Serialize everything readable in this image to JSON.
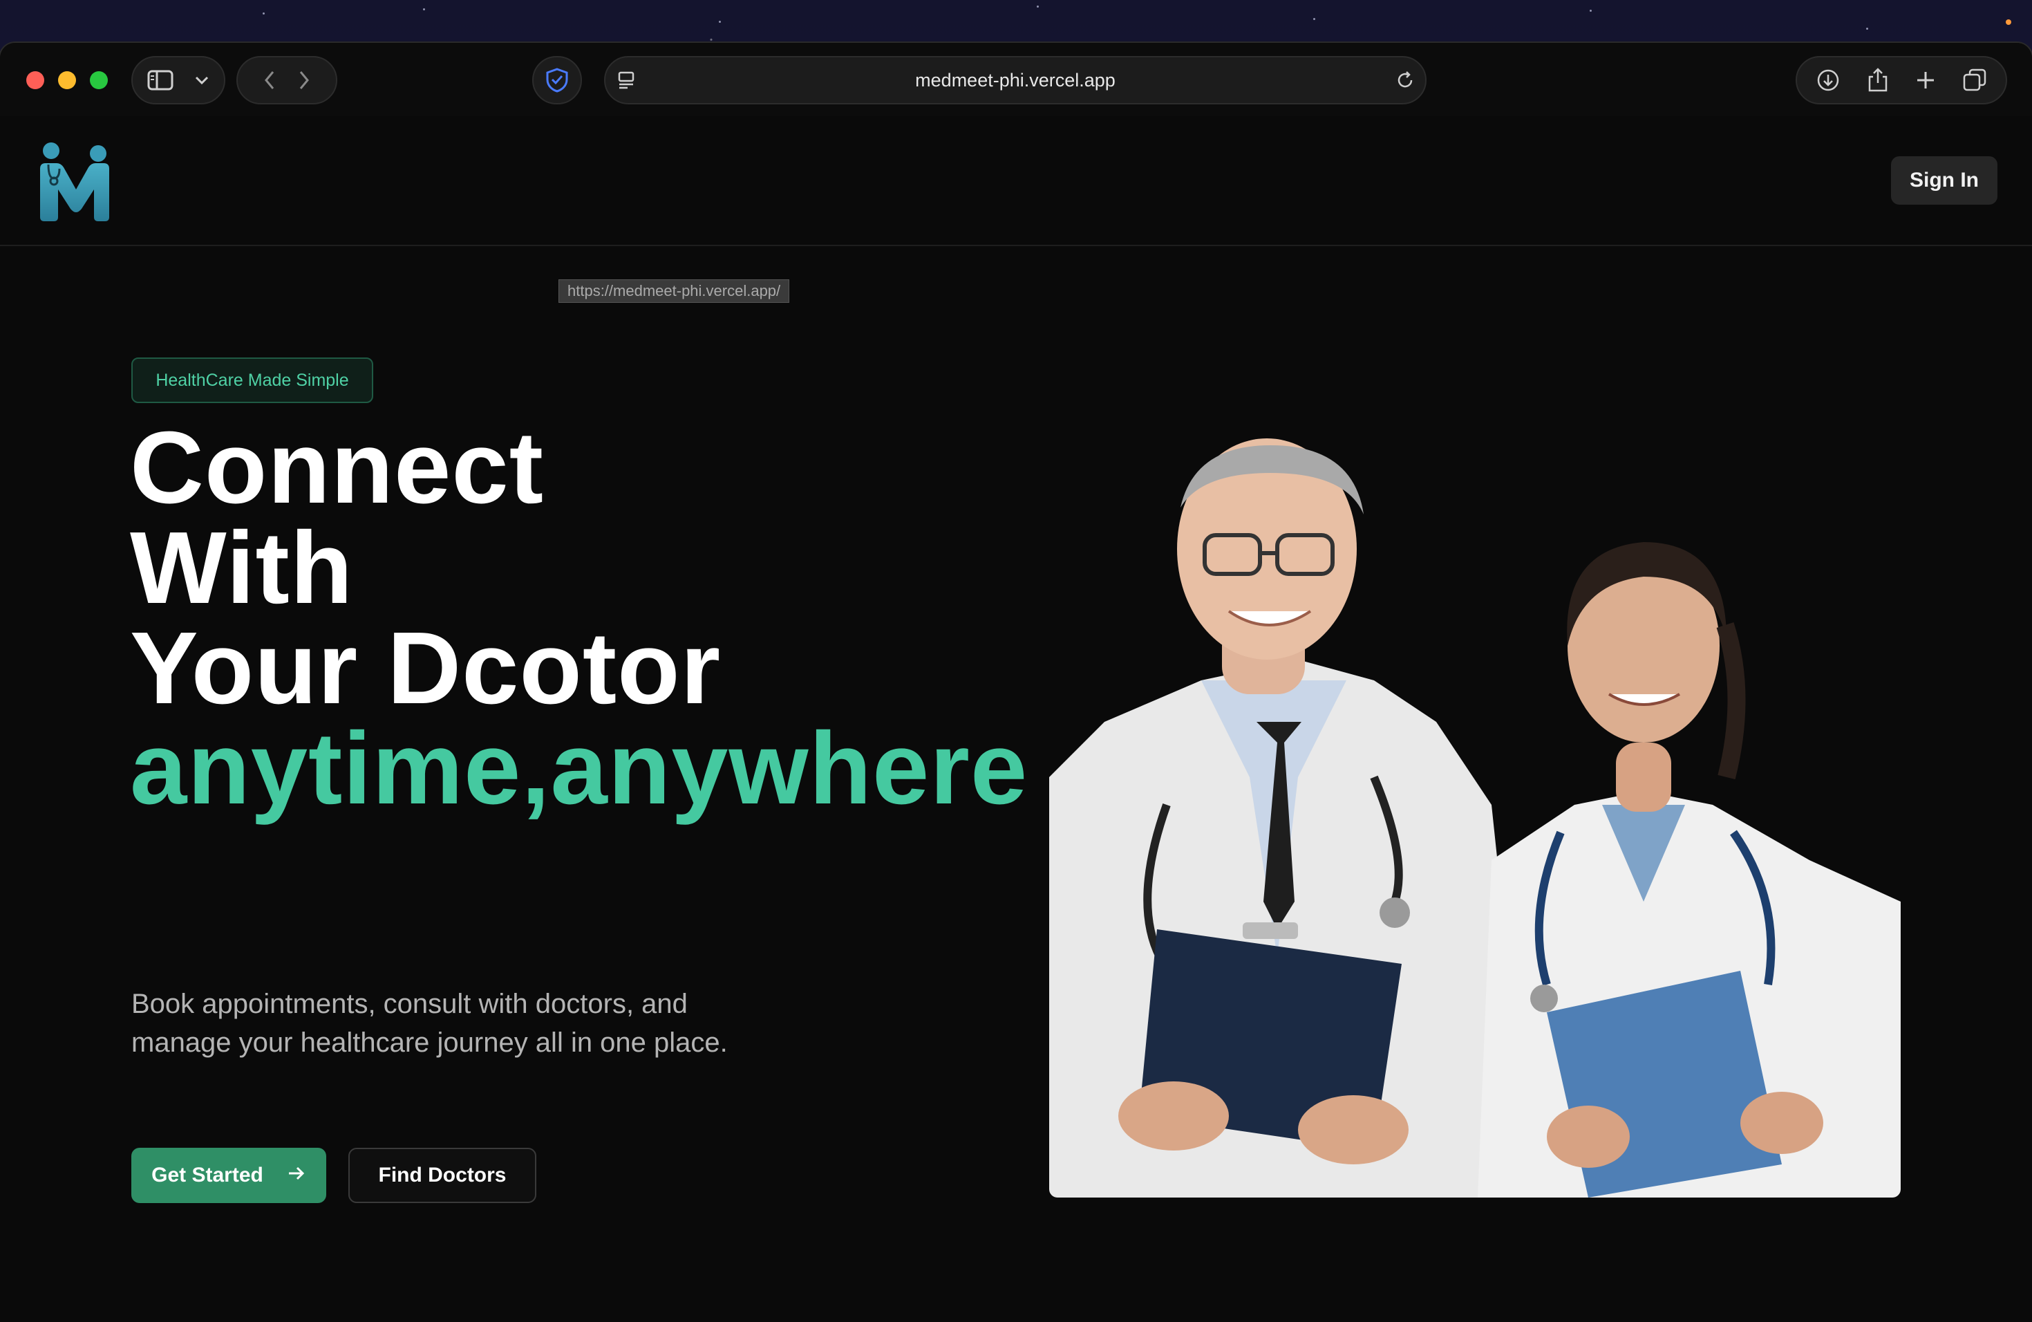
{
  "browser": {
    "url": "medmeet-phi.vercel.app",
    "hover_link": "https://medmeet-phi.vercel.app/"
  },
  "nav": {
    "sign_in": "Sign In"
  },
  "hero": {
    "badge": "HealthCare Made Simple",
    "headline_lines": [
      "Connect",
      "With",
      "Your Dcotor"
    ],
    "headline_accent": "anytime,anywhere",
    "subtitle": "Book appointments, consult with doctors, and manage your healthcare journey all in one place.",
    "primary_cta": "Get Started",
    "secondary_cta": "Find Doctors"
  },
  "colors": {
    "accent": "#45c9a0",
    "primary_button": "#2f8f66",
    "background": "#0a0a0a"
  },
  "icons": [
    "sidebar-icon",
    "chevron-down-icon",
    "back-icon",
    "forward-icon",
    "shield-icon",
    "page-icon",
    "reload-icon",
    "download-icon",
    "share-icon",
    "plus-icon",
    "tabs-icon",
    "arrow-right-icon"
  ]
}
